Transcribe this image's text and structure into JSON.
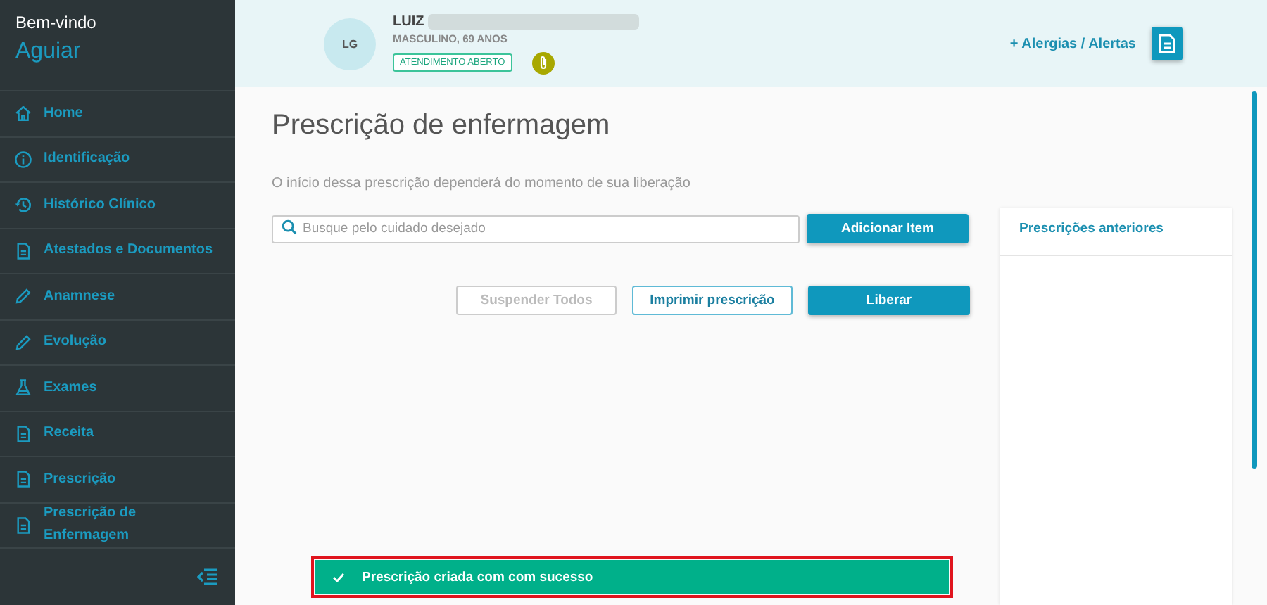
{
  "sidebar": {
    "greeting": "Bem-vindo",
    "user": "Aguiar",
    "items": [
      {
        "label": "Home",
        "selected": false
      },
      {
        "label": "Identificação",
        "selected": false
      },
      {
        "label": "Histórico Clínico",
        "selected": false
      },
      {
        "label": "Atestados e Documentos",
        "selected": false
      },
      {
        "label": "Anamnese",
        "selected": false
      },
      {
        "label": "Evolução",
        "selected": false
      },
      {
        "label": "Exames",
        "selected": false
      },
      {
        "label": "Receita",
        "selected": false
      },
      {
        "label": "Prescrição",
        "selected": false
      },
      {
        "label": "Prescrição de Enfermagem",
        "selected": false
      }
    ]
  },
  "patient": {
    "initials": "LG",
    "name": "LUIZ",
    "details": "MASCULINO, 69 ANOS",
    "status": "ATENDIMENTO ABERTO",
    "allergies_link": "+ Alergias / Alertas"
  },
  "page": {
    "title": "Prescrição de enfermagem",
    "subtitle": "O início dessa prescrição dependerá do momento de sua liberação",
    "search": {
      "placeholder": "Busque pelo cuidado desejado"
    },
    "add_button": "Adicionar Item",
    "buttons": [
      {
        "label": "Suspender Todos",
        "kind": "outline",
        "disabled": true
      },
      {
        "label": "Imprimir prescrição",
        "kind": "outline",
        "disabled": false
      },
      {
        "label": "Liberar",
        "kind": "primary",
        "disabled": false
      }
    ],
    "previous_panel": {
      "title": "Prescrições anteriores"
    }
  },
  "toast": {
    "message": "Prescrição criada com com sucesso",
    "kind": "success"
  }
}
